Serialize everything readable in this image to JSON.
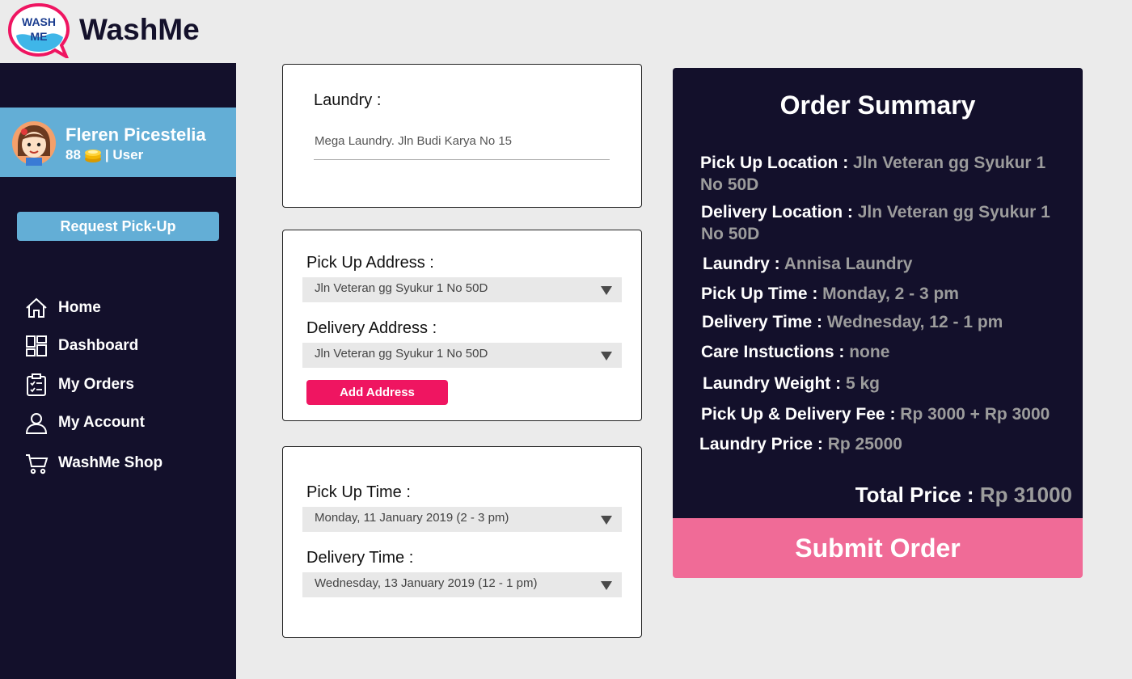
{
  "app": {
    "brand": "WashMe",
    "logo_text_top": "WASH",
    "logo_text_bottom": "ME",
    "logo_icon": "washme-logo"
  },
  "sidebar": {
    "user": {
      "name": "Fleren Picestelia",
      "coins": "88",
      "role": "| User",
      "avatar_icon": "girl-avatar",
      "coin_icon": "coin-icon"
    },
    "request_button": "Request Pick-Up",
    "nav": [
      {
        "label": "Home",
        "icon": "home-icon"
      },
      {
        "label": "Dashboard",
        "icon": "dashboard-icon"
      },
      {
        "label": "My Orders",
        "icon": "clipboard-icon"
      },
      {
        "label": "My Account",
        "icon": "user-icon"
      },
      {
        "label": "WashMe Shop",
        "icon": "cart-icon"
      }
    ]
  },
  "laundry_card": {
    "label": "Laundry :",
    "value": "Mega Laundry. Jln Budi Karya No 15"
  },
  "address_card": {
    "pickup_label": "Pick Up Address :",
    "pickup_value": "Jln Veteran gg Syukur 1 No 50D",
    "delivery_label": "Delivery Address :",
    "delivery_value": "Jln Veteran gg Syukur 1 No 50D",
    "add_button": "Add Address"
  },
  "time_card": {
    "pickup_label": "Pick Up Time :",
    "pickup_value": "Monday, 11 January 2019 (2 - 3 pm)",
    "delivery_label": "Delivery Time :",
    "delivery_value": "Wednesday, 13 January 2019 (12 - 1 pm)"
  },
  "summary": {
    "title": "Order Summary",
    "rows": [
      {
        "label": "Pick Up Location :",
        "value": "Jln Veteran gg Syukur 1 No 50D"
      },
      {
        "label": "Delivery Location :",
        "value": "Jln Veteran gg Syukur 1 No 50D"
      },
      {
        "label": "Laundry :",
        "value": "Annisa Laundry"
      },
      {
        "label": "Pick Up Time :",
        "value": "Monday, 2 - 3 pm"
      },
      {
        "label": "Delivery Time :",
        "value": "Wednesday, 12 - 1 pm"
      },
      {
        "label": "Care Instuctions :",
        "value": "none"
      },
      {
        "label": "Laundry Weight :",
        "value": "5 kg"
      },
      {
        "label": "Pick Up & Delivery Fee :",
        "value": "Rp 3000 + Rp 3000"
      },
      {
        "label": "Laundry Price :",
        "value": "Rp 25000"
      }
    ],
    "total_label": "Total Price :",
    "total_value": "Rp 31000",
    "submit_button": "Submit Order"
  },
  "colors": {
    "sidebar_bg": "#13102b",
    "accent_blue": "#63aed6",
    "accent_pink": "#ef1561",
    "submit_pink": "#f06b97"
  }
}
